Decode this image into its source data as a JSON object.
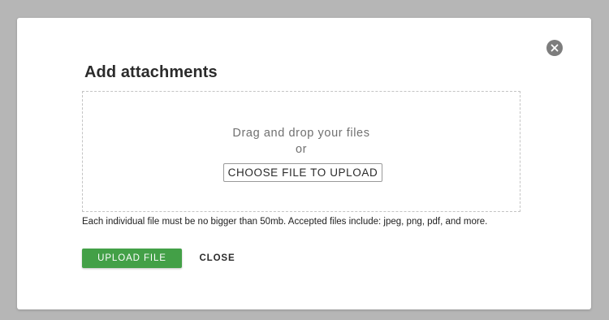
{
  "dialog": {
    "title": "Add attachments",
    "close_icon": "close-circle-icon",
    "dropzone": {
      "drag_text": "Drag and drop your files",
      "or_text": "or",
      "choose_button_label": "CHOOSE FILE TO UPLOAD"
    },
    "hint": "Each individual file must be no bigger than 50mb. Accepted files include: jpeg, png, pdf, and more.",
    "actions": {
      "upload_label": "UPLOAD FILE",
      "close_label": "CLOSE"
    }
  },
  "colors": {
    "overlay": "#b6b6b6",
    "dialog_background": "#ffffff",
    "primary_button": "#43a047",
    "close_icon": "#7d7d7d",
    "dropzone_border": "#c4c4c4"
  }
}
